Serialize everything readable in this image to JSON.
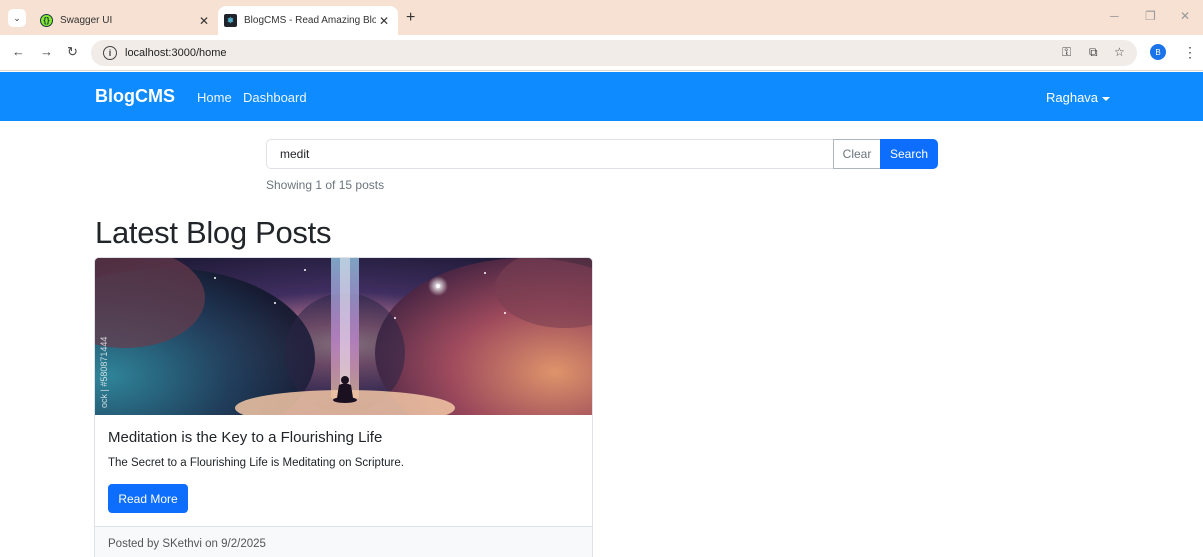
{
  "browser": {
    "tabs": [
      {
        "title": "Swagger UI",
        "favicon": "swagger-icon",
        "active": false
      },
      {
        "title": "BlogCMS - Read Amazing Blog",
        "favicon": "react-icon",
        "active": true
      }
    ],
    "url": "localhost:3000/home",
    "profile_initial": "B"
  },
  "navbar": {
    "brand": "BlogCMS",
    "links": [
      "Home",
      "Dashboard"
    ],
    "user": "Raghava",
    "color": "#0d8bff"
  },
  "search": {
    "value": "medit",
    "clear_label": "Clear",
    "search_label": "Search",
    "status": "Showing 1 of 15 posts"
  },
  "main": {
    "heading": "Latest Blog Posts",
    "posts": [
      {
        "title": "Meditation is the Key to a Flourishing Life",
        "excerpt": "The Secret to a Flourishing Life is Meditating on Scripture.",
        "cta": "Read More",
        "footer": "Posted by SKethvi on 9/2/2025",
        "image_watermark": "ock | #580871444"
      }
    ]
  }
}
